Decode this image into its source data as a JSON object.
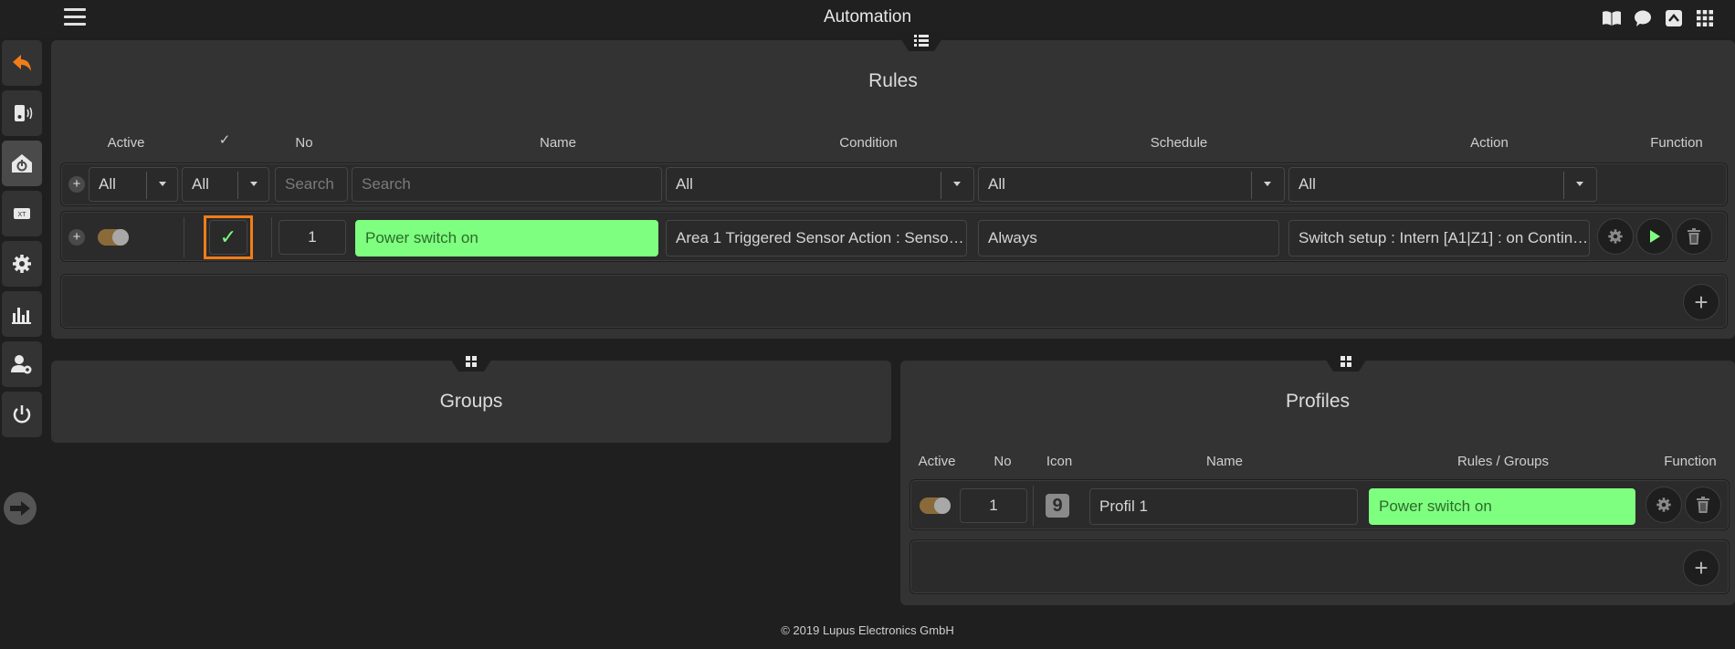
{
  "app": {
    "title": "Automation"
  },
  "colors": {
    "accent": "#f07d17",
    "green": "#7fff7f",
    "panel": "#333333"
  },
  "top_icons": [
    "book-icon",
    "chat-icon",
    "expand-up-icon",
    "apps-grid-icon"
  ],
  "sidebar": [
    "back-icon",
    "device-icon",
    "home-power-icon",
    "rf-icon",
    "gear-icon",
    "chart-icon",
    "user-settings-icon",
    "power-icon",
    "arrow-right-icon"
  ],
  "rules": {
    "title": "Rules",
    "columns": {
      "active": "Active",
      "check": "✓",
      "no": "No",
      "name": "Name",
      "condition": "Condition",
      "schedule": "Schedule",
      "action": "Action",
      "function": "Function"
    },
    "filters": {
      "active": "All",
      "check": "All",
      "no_placeholder": "Search",
      "name_placeholder": "Search",
      "condition": "All",
      "schedule": "All",
      "action": "All"
    },
    "rows": [
      {
        "active": true,
        "checked": "✓",
        "no": "1",
        "name": "Power switch on",
        "condition": "Area 1 Triggered Sensor Action : Sensor …",
        "schedule": "Always",
        "action": "Switch setup : Intern [A1|Z1] : on Contin…"
      }
    ]
  },
  "groups": {
    "title": "Groups"
  },
  "profiles": {
    "title": "Profiles",
    "columns": {
      "active": "Active",
      "no": "No",
      "icon": "Icon",
      "name": "Name",
      "rules_groups": "Rules / Groups",
      "function": "Function"
    },
    "rows": [
      {
        "active": true,
        "no": "1",
        "icon_label": "9",
        "name": "Profil 1",
        "rules_groups": "Power switch on"
      }
    ]
  },
  "footer": {
    "text": "© 2019 Lupus Electronics GmbH"
  }
}
